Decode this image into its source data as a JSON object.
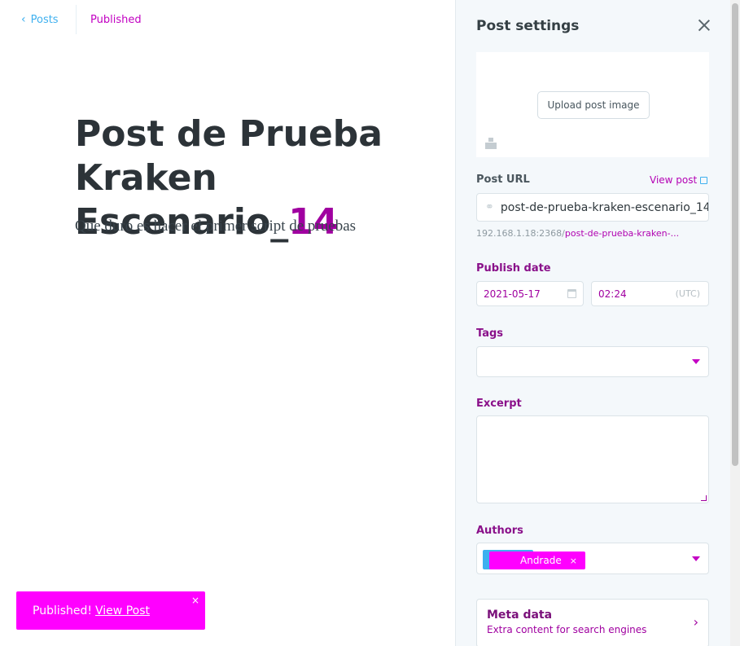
{
  "editor": {
    "back_label": "Posts",
    "status": "Published",
    "title_line1": "Post de Prueba Kraken",
    "title_line2_prefix": "Escenario_",
    "title_number": "14",
    "body": "Que duro es hacer el primer script de pruebas"
  },
  "toast": {
    "message": "Published!",
    "link": "View Post",
    "close": "×"
  },
  "panel": {
    "title": "Post settings",
    "upload_label": "Upload post image",
    "post_url_label": "Post URL",
    "view_post_label": "View post",
    "url_value": "post-de-prueba-kraken-escenario_14",
    "url_help_prefix": "192.168.1.18:2368/",
    "url_help_tail": "post-de-prueba-kraken-...",
    "publish_date_label": "Publish date",
    "date_value": "2021-05-17",
    "time_value": "02:24",
    "timezone": "(UTC)",
    "tags_label": "Tags",
    "excerpt_label": "Excerpt",
    "authors_label": "Authors",
    "author_name": "Andrade",
    "author_remove": "×",
    "meta_title": "Meta data",
    "meta_subtitle": "Extra content for search engines",
    "meta_chevron": "›"
  },
  "colors": {
    "accent": "#3eb0ef",
    "highlight": "#ff00ff"
  }
}
